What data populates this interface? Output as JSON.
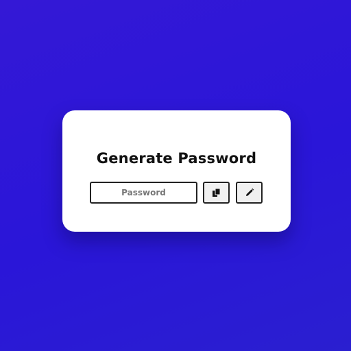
{
  "card": {
    "title": "Generate Password"
  },
  "password_field": {
    "value": "",
    "placeholder": "Password"
  },
  "buttons": {
    "copy_icon": "copy-icon",
    "generate_icon": "pencil-icon"
  },
  "colors": {
    "background": "#2a16d8",
    "card": "#ffffff",
    "border": "#222222"
  }
}
